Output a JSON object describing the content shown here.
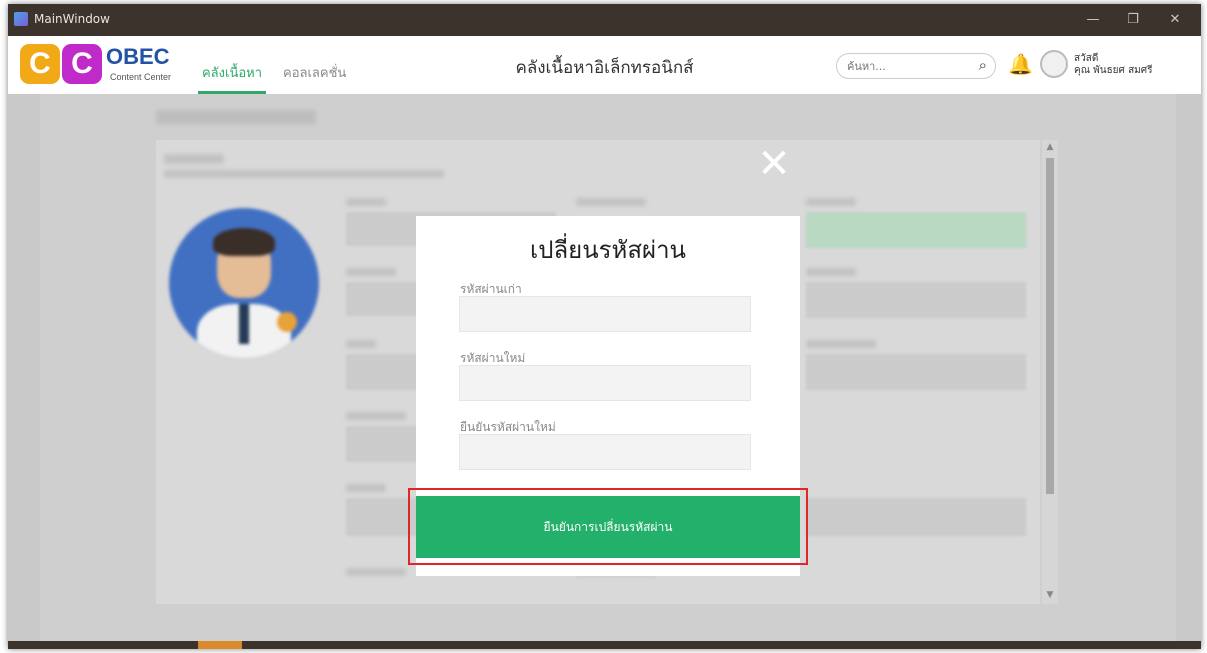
{
  "window": {
    "title": "MainWindow",
    "minimize_glyph": "—",
    "restore_glyph": "❐",
    "close_glyph": "✕"
  },
  "header": {
    "logo_c1": "C",
    "logo_c2": "C",
    "brand": "OBEC",
    "brand_sub": "Content Center",
    "tabs": [
      {
        "label": "คลังเนื้อหา",
        "active": true
      },
      {
        "label": "คอลเลคชั่น",
        "active": false
      }
    ],
    "title": "คลังเนื้อหาอิเล็กทรอนิกส์",
    "search": {
      "placeholder": "ค้นหา...",
      "icon": "search-icon"
    },
    "bell_icon": "bell-icon",
    "user": {
      "greeting": "สวัสดี",
      "name": "คุณ พันธยศ สมศรี"
    }
  },
  "modal": {
    "close_glyph": "✕",
    "title": "เปลี่ยนรหัสผ่าน",
    "fields": [
      {
        "label": "รหัสผ่านเก่า",
        "value": ""
      },
      {
        "label": "รหัสผ่านใหม่",
        "value": ""
      },
      {
        "label": "ยืนยันรหัสผ่านใหม่",
        "value": ""
      }
    ],
    "submit_label": "ยืนยันการเปลี่ยนรหัสผ่าน"
  },
  "colors": {
    "accent_green": "#23b06a",
    "highlight_red": "#e0262a",
    "brand_blue": "#2254a3"
  }
}
